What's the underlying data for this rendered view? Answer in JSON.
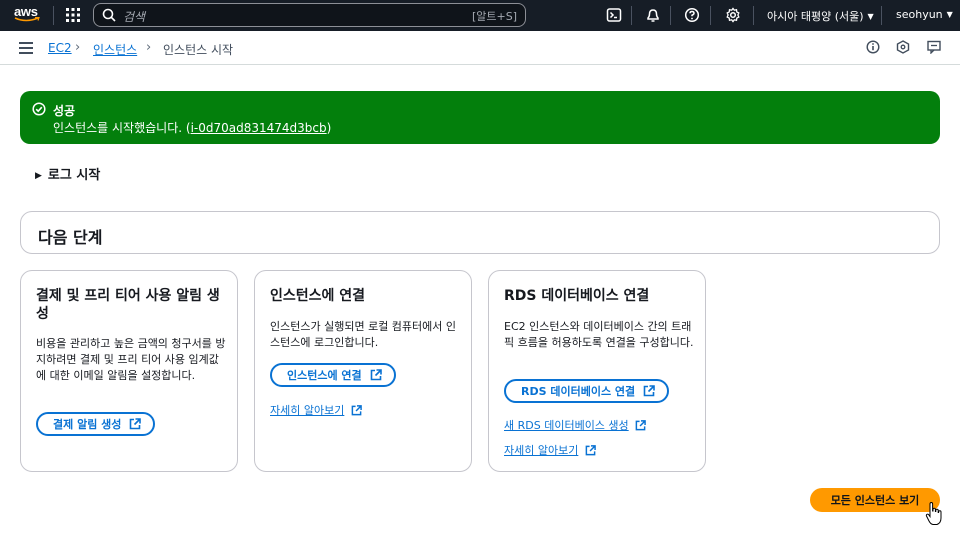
{
  "topnav": {
    "logo": "aws",
    "search_placeholder": "검색",
    "search_shortcut": "[알트+S]",
    "region": "아시아 태평양 (서울)",
    "user": "seohyun"
  },
  "breadcrumb": {
    "items": [
      "EC2",
      "인스턴스",
      "인스턴스 시작"
    ]
  },
  "flash": {
    "title": "성공",
    "message": "인스턴스를 시작했습니다. (",
    "instance_id": "i-0d70ad831474d3bcb",
    "message_end": ")"
  },
  "logs_toggle": "로그 시작",
  "next_steps": {
    "title": "다음 단계",
    "cards": [
      {
        "title": "결제 및 프리 티어 사용 알림 생성",
        "description": "비용을 관리하고 높은 금액의 청구서를 방지하려면 결제 및 프리 티어 사용 임계값에 대한 이메일 알림을 설정합니다.",
        "button": "결제 알림 생성"
      },
      {
        "title": "인스턴스에 연결",
        "description": "인스턴스가 실행되면 로컬 컴퓨터에서 인스턴스에 로그인합니다.",
        "button": "인스턴스에 연결",
        "link": "자세히 알아보기"
      },
      {
        "title": "RDS 데이터베이스 연결",
        "description": "EC2 인스턴스와 데이터베이스 간의 트래픽 흐름을 허용하도록 연결을 구성합니다.",
        "button": "RDS 데이터베이스 연결",
        "link1": "새 RDS 데이터베이스 생성",
        "link2": "자세히 알아보기"
      }
    ]
  },
  "primary_button": "모든 인스턴스 보기",
  "colors": {
    "nav_bg": "#161d26",
    "success": "#037f0c",
    "link": "#0972d3",
    "primary": "#ff9900"
  }
}
